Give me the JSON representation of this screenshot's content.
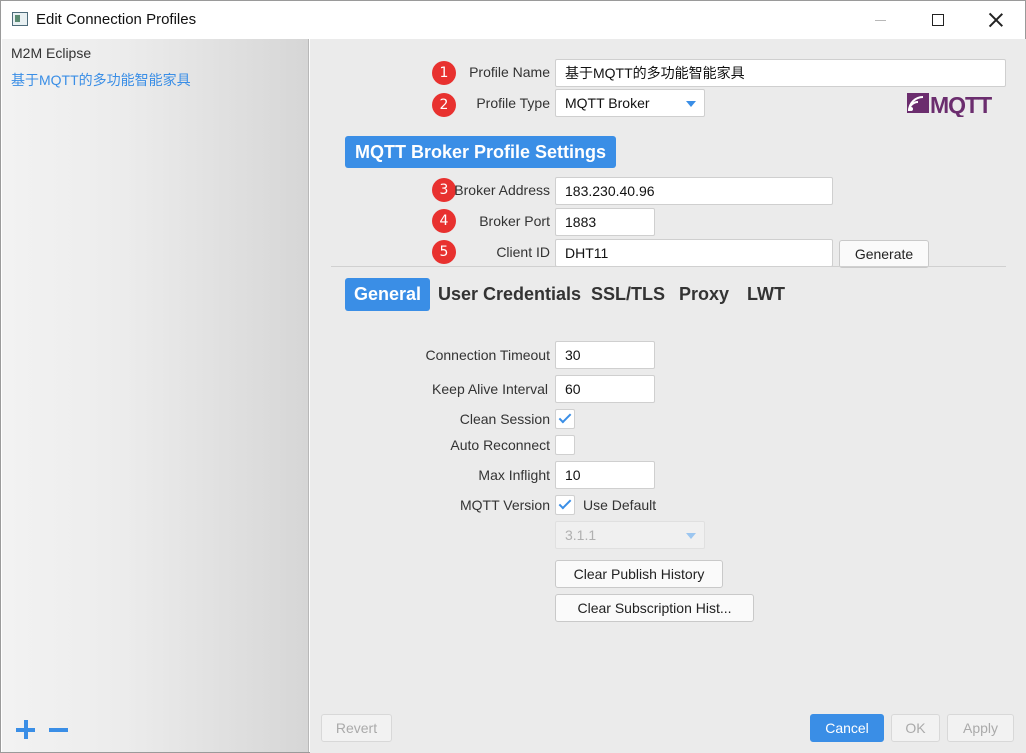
{
  "window": {
    "title": "Edit Connection Profiles"
  },
  "sidebar": {
    "profiles": [
      {
        "label": "M2M Eclipse"
      },
      {
        "label": "基于MQTT的多功能智能家具"
      }
    ]
  },
  "form": {
    "profile_name": {
      "label": "Profile Name",
      "value": "基于MQTT的多功能智能家具",
      "badge": "1"
    },
    "profile_type": {
      "label": "Profile Type",
      "value": "MQTT Broker",
      "badge": "2"
    },
    "logo_text": "MQTT",
    "section_title": "MQTT Broker Profile Settings",
    "broker_address": {
      "label": "Broker Address",
      "value": "183.230.40.96",
      "badge": "3"
    },
    "broker_port": {
      "label": "Broker Port",
      "value": "1883",
      "badge": "4"
    },
    "client_id": {
      "label": "Client ID",
      "value": "DHT11",
      "badge": "5"
    },
    "generate_label": "Generate"
  },
  "tabs": [
    {
      "label": "General",
      "active": true
    },
    {
      "label": "User Credentials",
      "active": false
    },
    {
      "label": "SSL/TLS",
      "active": false
    },
    {
      "label": "Proxy",
      "active": false
    },
    {
      "label": "LWT",
      "active": false
    }
  ],
  "general": {
    "connection_timeout": {
      "label": "Connection Timeout",
      "value": "30"
    },
    "keep_alive": {
      "label": "Keep Alive Interval",
      "value": "60"
    },
    "clean_session": {
      "label": "Clean Session",
      "checked": true
    },
    "auto_reconnect": {
      "label": "Auto Reconnect",
      "checked": false
    },
    "max_inflight": {
      "label": "Max Inflight",
      "value": "10"
    },
    "mqtt_version": {
      "label": "MQTT Version",
      "use_default_label": "Use Default",
      "checked": true,
      "version_value": "3.1.1"
    },
    "clear_publish_label": "Clear Publish History",
    "clear_subscription_label": "Clear Subscription Hist..."
  },
  "footer": {
    "revert": "Revert",
    "cancel": "Cancel",
    "ok": "OK",
    "apply": "Apply"
  },
  "colors": {
    "accent": "#3a8ee6",
    "badge": "#e8312f",
    "logo_purple": "#6b2d6e"
  }
}
